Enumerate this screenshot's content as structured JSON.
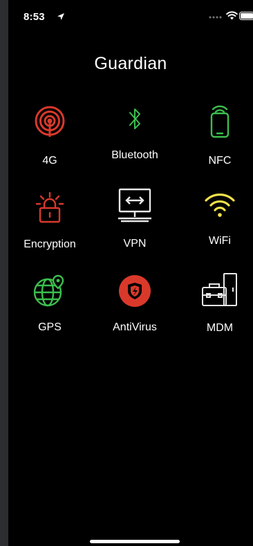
{
  "status_bar": {
    "time": "8:53",
    "icons": [
      "location-arrow-icon",
      "signal-dots-icon",
      "wifi-icon",
      "battery-icon"
    ]
  },
  "title": "Guardian",
  "colors": {
    "red": "#d9392b",
    "green": "#3cbf4e",
    "yellow": "#f2e04a",
    "white": "#ffffff",
    "background": "#000000"
  },
  "tiles": [
    {
      "label": "4G",
      "icon": "cellular-signal-icon"
    },
    {
      "label": "Bluetooth",
      "icon": "bluetooth-icon"
    },
    {
      "label": "NFC",
      "icon": "nfc-phone-icon"
    },
    {
      "label": "Encryption",
      "icon": "lock-alarm-icon"
    },
    {
      "label": "VPN",
      "icon": "vpn-monitor-icon"
    },
    {
      "label": "WiFi",
      "icon": "wifi-icon"
    },
    {
      "label": "GPS",
      "icon": "globe-pin-icon"
    },
    {
      "label": "AntiVirus",
      "icon": "shield-icon"
    },
    {
      "label": "MDM",
      "icon": "toolbox-icon"
    }
  ]
}
